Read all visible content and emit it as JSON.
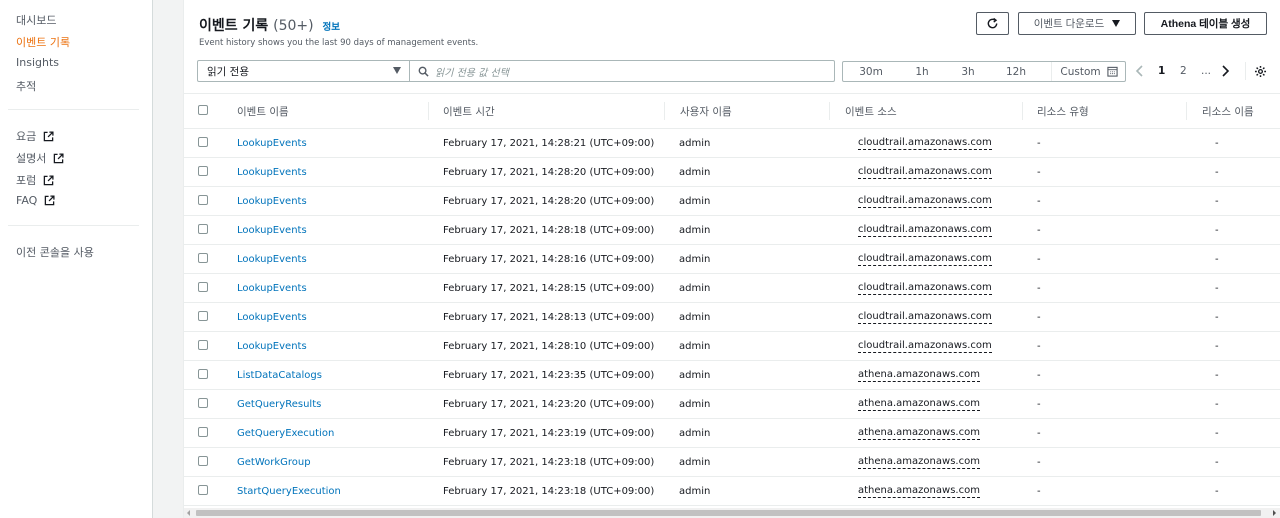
{
  "sidebar": {
    "items": [
      {
        "label": "대시보드",
        "active": false
      },
      {
        "label": "이벤트 기록",
        "active": true
      },
      {
        "label": "Insights",
        "active": false
      },
      {
        "label": "추적",
        "active": false
      }
    ],
    "external_links": [
      {
        "label": "요금",
        "icon": "external-link-icon"
      },
      {
        "label": "설명서",
        "icon": "external-link-icon"
      },
      {
        "label": "포럼",
        "icon": "external-link-icon"
      },
      {
        "label": "FAQ",
        "icon": "external-link-icon"
      }
    ],
    "legacy_console": "이전 콘솔을 사용"
  },
  "header": {
    "title": "이벤트 기록",
    "count": "(50+)",
    "info": "정보",
    "description": "Event history shows you the last 90 days of management events.",
    "refresh_icon": "refresh-icon",
    "download_label": "이벤트 다운로드",
    "athena_label": "Athena 테이블 생성"
  },
  "filter": {
    "attribute": "읽기 전용",
    "search_placeholder": "읽기 전용 값 선택"
  },
  "time_range": {
    "options": [
      "30m",
      "1h",
      "3h",
      "12h"
    ],
    "custom_label": "Custom"
  },
  "pagination": {
    "current": "1",
    "next": "2",
    "ellipsis": "..."
  },
  "table": {
    "columns": [
      "이벤트 이름",
      "이벤트 시간",
      "사용자 이름",
      "이벤트 소스",
      "리소스 유형",
      "리소스 이름"
    ],
    "rows": [
      {
        "name": "LookupEvents",
        "time": "February 17, 2021, 14:28:21 (UTC+09:00)",
        "user": "admin",
        "source": "cloudtrail.amazonaws.com",
        "resource_type": "-",
        "resource_name": "-"
      },
      {
        "name": "LookupEvents",
        "time": "February 17, 2021, 14:28:20 (UTC+09:00)",
        "user": "admin",
        "source": "cloudtrail.amazonaws.com",
        "resource_type": "-",
        "resource_name": "-"
      },
      {
        "name": "LookupEvents",
        "time": "February 17, 2021, 14:28:20 (UTC+09:00)",
        "user": "admin",
        "source": "cloudtrail.amazonaws.com",
        "resource_type": "-",
        "resource_name": "-"
      },
      {
        "name": "LookupEvents",
        "time": "February 17, 2021, 14:28:18 (UTC+09:00)",
        "user": "admin",
        "source": "cloudtrail.amazonaws.com",
        "resource_type": "-",
        "resource_name": "-"
      },
      {
        "name": "LookupEvents",
        "time": "February 17, 2021, 14:28:16 (UTC+09:00)",
        "user": "admin",
        "source": "cloudtrail.amazonaws.com",
        "resource_type": "-",
        "resource_name": "-"
      },
      {
        "name": "LookupEvents",
        "time": "February 17, 2021, 14:28:15 (UTC+09:00)",
        "user": "admin",
        "source": "cloudtrail.amazonaws.com",
        "resource_type": "-",
        "resource_name": "-"
      },
      {
        "name": "LookupEvents",
        "time": "February 17, 2021, 14:28:13 (UTC+09:00)",
        "user": "admin",
        "source": "cloudtrail.amazonaws.com",
        "resource_type": "-",
        "resource_name": "-"
      },
      {
        "name": "LookupEvents",
        "time": "February 17, 2021, 14:28:10 (UTC+09:00)",
        "user": "admin",
        "source": "cloudtrail.amazonaws.com",
        "resource_type": "-",
        "resource_name": "-"
      },
      {
        "name": "ListDataCatalogs",
        "time": "February 17, 2021, 14:23:35 (UTC+09:00)",
        "user": "admin",
        "source": "athena.amazonaws.com",
        "resource_type": "-",
        "resource_name": "-"
      },
      {
        "name": "GetQueryResults",
        "time": "February 17, 2021, 14:23:20 (UTC+09:00)",
        "user": "admin",
        "source": "athena.amazonaws.com",
        "resource_type": "-",
        "resource_name": "-"
      },
      {
        "name": "GetQueryExecution",
        "time": "February 17, 2021, 14:23:19 (UTC+09:00)",
        "user": "admin",
        "source": "athena.amazonaws.com",
        "resource_type": "-",
        "resource_name": "-"
      },
      {
        "name": "GetWorkGroup",
        "time": "February 17, 2021, 14:23:18 (UTC+09:00)",
        "user": "admin",
        "source": "athena.amazonaws.com",
        "resource_type": "-",
        "resource_name": "-"
      },
      {
        "name": "StartQueryExecution",
        "time": "February 17, 2021, 14:23:18 (UTC+09:00)",
        "user": "admin",
        "source": "athena.amazonaws.com",
        "resource_type": "-",
        "resource_name": "-"
      }
    ]
  },
  "colors": {
    "accent": "#ec7211",
    "link": "#0073bb",
    "text": "#16191f",
    "muted": "#545b64"
  }
}
